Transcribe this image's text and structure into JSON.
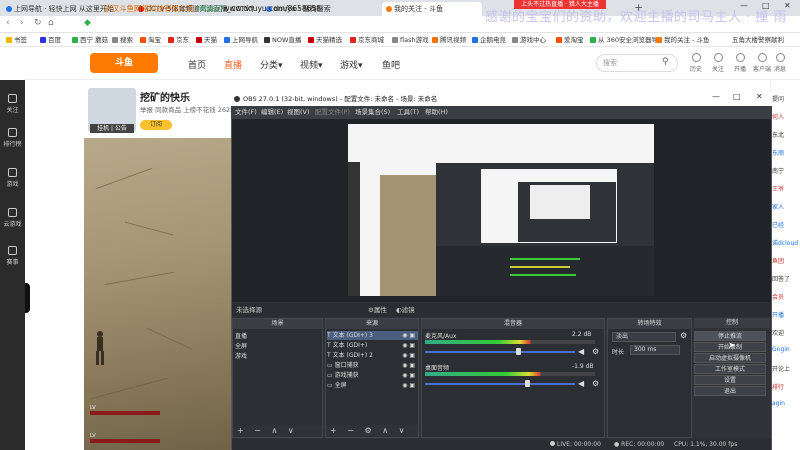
{
  "browser": {
    "tabs": [
      {
        "label": "上网导航 · 轻快上网 从这里开始",
        "color": "#1a73e8"
      },
      {
        "label": "CCTV-5体育频道高清直播_CCTV节目官网",
        "color": "#c00"
      },
      {
        "label": "douyu - 搜狗搜索",
        "color": "#3b7ded"
      },
      {
        "label": "我的关注 - 斗鱼",
        "color": "#ff7a00"
      }
    ],
    "active_tab": 3,
    "new_tab": "+",
    "window_buttons": [
      "—",
      "□",
      "✕"
    ],
    "url_site": "武汉斗鱼网络科技有限公司",
    "url_scheme": "https://",
    "url_host": "www.douyu.com/8658658",
    "bookmarks": [
      {
        "label": "书签",
        "color": "#f4b400"
      },
      {
        "label": "百度",
        "color": "#2932e1"
      },
      {
        "label": "西宁 蘑菇",
        "color": "#2bb24c"
      },
      {
        "label": "搜索",
        "color": "#888"
      },
      {
        "label": "淘宝",
        "color": "#ff5000"
      },
      {
        "label": "京东",
        "color": "#e1251b"
      },
      {
        "label": "天猫",
        "color": "#c40000"
      },
      {
        "label": "上网导航",
        "color": "#1a73e8"
      },
      {
        "label": "NOW直播",
        "color": "#333"
      },
      {
        "label": "天猫精选",
        "color": "#c40000"
      },
      {
        "label": "京东商城",
        "color": "#e1251b"
      },
      {
        "label": "flash游戏",
        "color": "#888"
      },
      {
        "label": "腾讯视频",
        "color": "#ff6f00"
      },
      {
        "label": "企鹅电竞",
        "color": "#1a73e8"
      },
      {
        "label": "游戏中心",
        "color": "#888"
      },
      {
        "label": "爱淘宝",
        "color": "#ff5000"
      },
      {
        "label": "从 360安全浏览器导",
        "color": "#2bb24c"
      },
      {
        "label": "我的关注 - 斗鱼",
        "color": "#ff7a00"
      }
    ],
    "bookmark_right": "五角大楼警察献利"
  },
  "overlay": {
    "banner": "上头不过热直播 · 猎人大主播",
    "watermark": "感谢的宝宝们的资助，欢迎主播的司马主人 · 撞  雨"
  },
  "douyu": {
    "logo": "斗鱼",
    "nav": [
      "首页",
      "直播",
      "分类▾",
      "视频▾",
      "游戏▾",
      "鱼吧"
    ],
    "active_nav": 1,
    "search_placeholder": "搜索",
    "header_icons": [
      "历史",
      "关注",
      "开播",
      "客户端",
      "消息"
    ],
    "rail": [
      "关注",
      "排行榜",
      "游戏",
      "云游戏",
      "赛事"
    ],
    "room_title": "挖矿的快乐",
    "room_sub": "举报   同款商品   上榜不花钱   2625   我的斗鱼",
    "room_avatar_tag": "挂机 | 公告",
    "subscribe": "订阅",
    "hp_labels": [
      "LV",
      "LV"
    ],
    "right_chat": [
      {
        "text": "提问",
        "color": "#333"
      },
      {
        "text": "何人",
        "color": "#c33"
      },
      {
        "text": "东北",
        "color": "#333"
      },
      {
        "text": "东丽",
        "color": "#1a73e8"
      },
      {
        "text": "南宁",
        "color": "#333"
      },
      {
        "text": "王爷",
        "color": "#c33"
      },
      {
        "text": "家人",
        "color": "#1a73e8"
      },
      {
        "text": "已经",
        "color": "#1a73e8"
      },
      {
        "text": "诺dcloud",
        "color": "#1a73e8"
      },
      {
        "text": "鱼团",
        "color": "#c33"
      },
      {
        "text": "回答了",
        "color": "#333"
      },
      {
        "text": "会员",
        "color": "#c33"
      },
      {
        "text": "开播",
        "color": "#1a73e8"
      },
      {
        "text": "欢迎",
        "color": "#333"
      },
      {
        "text": "Gngin",
        "color": "#1a73e8"
      },
      {
        "text": "开论上",
        "color": "#333"
      },
      {
        "text": "排行",
        "color": "#c33"
      },
      {
        "text": "agin",
        "color": "#1a73e8"
      }
    ]
  },
  "obs": {
    "title": "OBS 27.0.1 (32-bit, windows) - 配置文件: 未命名 - 场景: 未命名",
    "window_buttons": [
      "—",
      "□",
      "✕"
    ],
    "menu": [
      "文件(F)",
      "编辑(E)",
      "视图(V)",
      "配置文件(P)",
      "场景集合(S)",
      "工具(T)",
      "帮助(H)"
    ],
    "source_status": "未选择源",
    "properties_btn": "属性",
    "filters_btn": "滤镜",
    "scenes": {
      "header": "场景",
      "items": [
        "直播",
        "全屏",
        "游戏"
      ],
      "footer": "+ − ∧ ∨"
    },
    "sources": {
      "header": "来源",
      "items": [
        {
          "icon": "T",
          "label": "文本 (GDI+) 3",
          "selected": true
        },
        {
          "icon": "T",
          "label": "文本 (GDI+)",
          "selected": false
        },
        {
          "icon": "T",
          "label": "文本 (GDI+) 2",
          "selected": false
        },
        {
          "icon": "▭",
          "label": "窗口捕获",
          "selected": false
        },
        {
          "icon": "▭",
          "label": "游戏捕获",
          "selected": false
        },
        {
          "icon": "▭",
          "label": "全屏",
          "selected": false
        }
      ],
      "footer": "+ − ⚙ ∧ ∨"
    },
    "mixer": {
      "header": "混音器",
      "channels": [
        {
          "name": "麦克风/Aux",
          "value": "2.2 dB",
          "level": 0.62
        },
        {
          "name": "桌面音频",
          "value": "-1.9 dB",
          "level": 0.68
        }
      ]
    },
    "transitions": {
      "header": "转场特效",
      "type": "淡出",
      "duration_label": "时长",
      "duration": "300 ms"
    },
    "controls": {
      "header": "控制",
      "buttons": [
        "停止推流",
        "开始录制",
        "启动虚拟摄像机",
        "工作室模式",
        "设置",
        "退出"
      ]
    },
    "status": {
      "live_label": "LIVE:",
      "live_time": "00:00:00",
      "rec_label": "REC:",
      "rec_time": "00:00:00",
      "cpu": "CPU: 1.1%, 30.00 fps"
    }
  }
}
